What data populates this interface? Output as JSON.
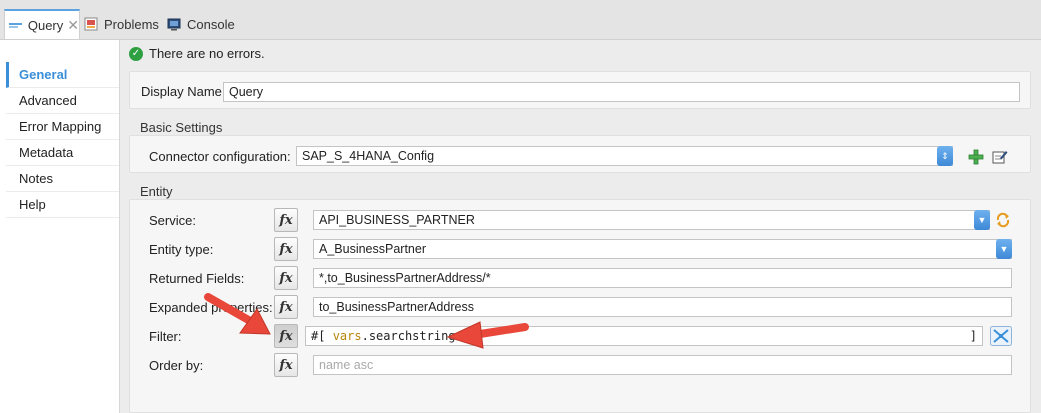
{
  "tabs": [
    {
      "label": "Query",
      "icon": "mule-icon",
      "active": true
    },
    {
      "label": "Problems",
      "icon": "problems-icon"
    },
    {
      "label": "Console",
      "icon": "console-icon"
    }
  ],
  "nav": {
    "items": [
      "General",
      "Advanced",
      "Error Mapping",
      "Metadata",
      "Notes",
      "Help"
    ],
    "active": "General"
  },
  "status": {
    "text": "There are no errors."
  },
  "general": {
    "display_name_label": "Display Name:",
    "display_name_value": "Query"
  },
  "basic": {
    "title": "Basic Settings",
    "connector_label": "Connector configuration:",
    "connector_value": "SAP_S_4HANA_Config"
  },
  "entity": {
    "title": "Entity",
    "service_label": "Service:",
    "service_value": "API_BUSINESS_PARTNER",
    "entity_type_label": "Entity type:",
    "entity_type_value": "A_BusinessPartner",
    "returned_label": "Returned Fields:",
    "returned_value": "*,to_BusinessPartnerAddress/*",
    "expanded_label": "Expanded properties:",
    "expanded_value": "to_BusinessPartnerAddress",
    "filter_label": "Filter:",
    "filter_prefix": "#[",
    "filter_vars": "vars",
    "filter_rest": ".searchstring",
    "filter_suffix": "]",
    "orderby_label": "Order by:",
    "orderby_placeholder": "name asc",
    "fx_label": "fx"
  },
  "colors": {
    "accent": "#3a8fd8",
    "arrow": "#e8473a",
    "ok": "#2fa042"
  }
}
